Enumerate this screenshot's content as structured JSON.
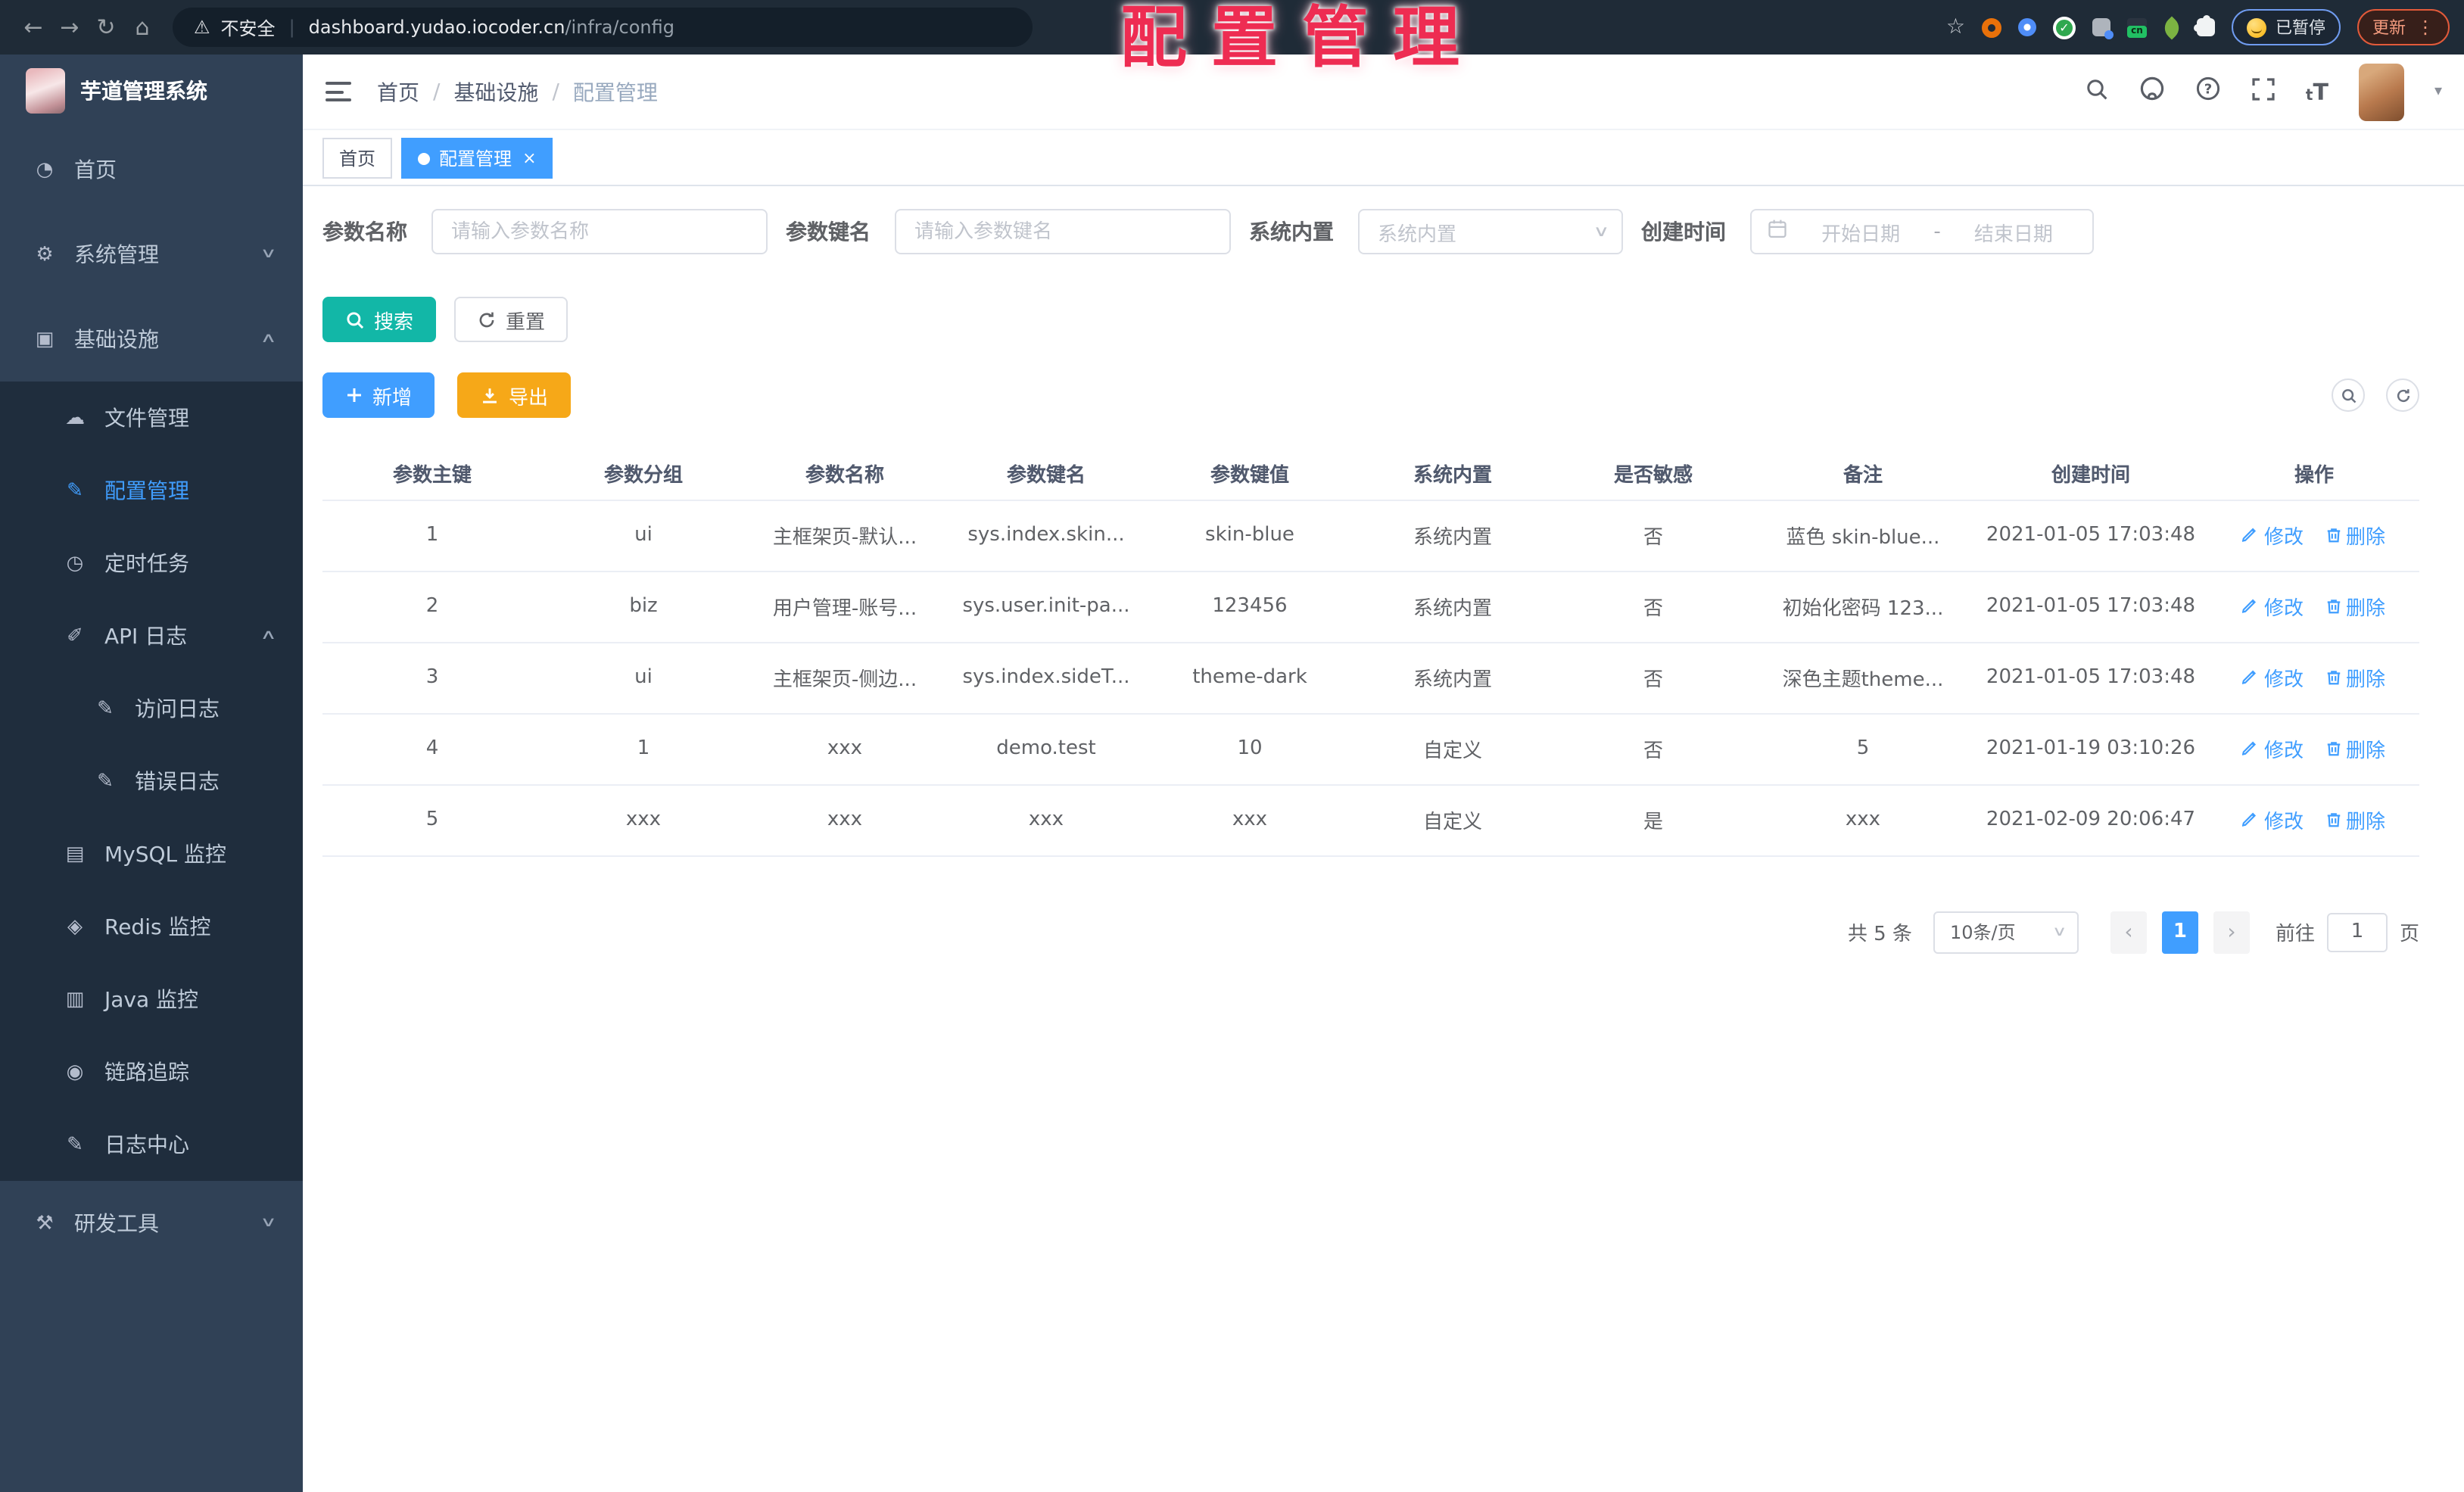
{
  "browser": {
    "security_label": "不安全",
    "url_host": "dashboard.yudao.iocoder.cn",
    "url_path": "/infra/config",
    "paused_label": "已暂停",
    "update_label": "更新"
  },
  "watermark": {
    "text": "配置管理"
  },
  "sidebar": {
    "title": "芋道管理系统",
    "items": [
      {
        "label": "首页"
      },
      {
        "label": "系统管理"
      },
      {
        "label": "基础设施"
      },
      {
        "label": "文件管理"
      },
      {
        "label": "配置管理"
      },
      {
        "label": "定时任务"
      },
      {
        "label": "API 日志"
      },
      {
        "label": "访问日志"
      },
      {
        "label": "错误日志"
      },
      {
        "label": "MySQL 监控"
      },
      {
        "label": "Redis 监控"
      },
      {
        "label": "Java 监控"
      },
      {
        "label": "链路追踪"
      },
      {
        "label": "日志中心"
      },
      {
        "label": "研发工具"
      }
    ]
  },
  "header": {
    "breadcrumb": [
      "首页",
      "基础设施",
      "配置管理"
    ]
  },
  "tabs": [
    {
      "label": "首页"
    },
    {
      "label": "配置管理"
    }
  ],
  "filters": {
    "name_label": "参数名称",
    "name_placeholder": "请输入参数名称",
    "key_label": "参数键名",
    "key_placeholder": "请输入参数键名",
    "type_label": "系统内置",
    "type_placeholder": "系统内置",
    "date_label": "创建时间",
    "date_start_placeholder": "开始日期",
    "date_separator": "-",
    "date_end_placeholder": "结束日期",
    "search_label": "搜索",
    "reset_label": "重置"
  },
  "toolbar": {
    "add_label": "新增",
    "export_label": "导出"
  },
  "table": {
    "headers": [
      "参数主键",
      "参数分组",
      "参数名称",
      "参数键名",
      "参数键值",
      "系统内置",
      "是否敏感",
      "备注",
      "创建时间",
      "操作"
    ],
    "edit_label": "修改",
    "delete_label": "删除",
    "rows": [
      {
        "cells": [
          "1",
          "ui",
          "主框架页-默认...",
          "sys.index.skin...",
          "skin-blue",
          "系统内置",
          "否",
          "蓝色 skin-blue...",
          "2021-01-05 17:03:48"
        ]
      },
      {
        "cells": [
          "2",
          "biz",
          "用户管理-账号...",
          "sys.user.init-pa...",
          "123456",
          "系统内置",
          "否",
          "初始化密码 123...",
          "2021-01-05 17:03:48"
        ]
      },
      {
        "cells": [
          "3",
          "ui",
          "主框架页-侧边...",
          "sys.index.sideT...",
          "theme-dark",
          "系统内置",
          "否",
          "深色主题theme...",
          "2021-01-05 17:03:48"
        ]
      },
      {
        "cells": [
          "4",
          "1",
          "xxx",
          "demo.test",
          "10",
          "自定义",
          "否",
          "5",
          "2021-01-19 03:10:26"
        ]
      },
      {
        "cells": [
          "5",
          "xxx",
          "xxx",
          "xxx",
          "xxx",
          "自定义",
          "是",
          "xxx",
          "2021-02-09 20:06:47"
        ]
      }
    ]
  },
  "pagination": {
    "total": "共 5 条",
    "page_size": "10条/页",
    "current_page": "1",
    "prev_icon": "‹",
    "next_icon": "›",
    "goto_label": "前往",
    "goto_value": "1",
    "unit_label": "页"
  },
  "colors": {
    "accent": "#409eff",
    "search_button": "#12b7a7",
    "export_button": "#f6a818",
    "watermark": "#ee2c52",
    "sidebar_bg": "#304156",
    "submenu_bg": "#1f2d3d",
    "chrome_bg": "#1f2b37"
  }
}
